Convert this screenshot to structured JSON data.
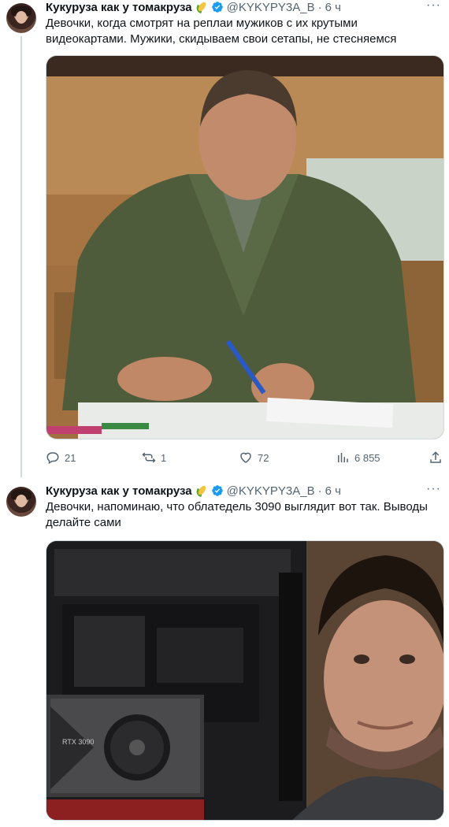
{
  "tweets": [
    {
      "author_name": "Кукуруза как у томакруза",
      "emoji": "corn-emoji",
      "handle": "@KYKYPY3A_B",
      "dot": "·",
      "time": "6 ч",
      "text": "Девочки, когда смотрят на реплаи мужиков с их крутыми видеокартами. Мужики, скидываем свои сетапы, не стесняемся",
      "media_description_icon": "man-writing-photo",
      "actions": {
        "replies": "21",
        "retweets": "1",
        "likes": "72",
        "views": "6 855"
      }
    },
    {
      "author_name": "Кукуруза как у томакруза",
      "emoji": "corn-emoji",
      "handle": "@KYKYPY3A_B",
      "dot": "·",
      "time": "6 ч",
      "text": "Девочки, напоминаю, что облатедель 3090 выглядит вот так. Выводы делайте сами",
      "media_description_icon": "man-with-gpu-photo",
      "gpu_label": "RTX 3090"
    }
  ],
  "colors": {
    "verified_blue": "#1d9bf0",
    "secondary_text": "#536471",
    "primary_text": "#0f1419"
  }
}
